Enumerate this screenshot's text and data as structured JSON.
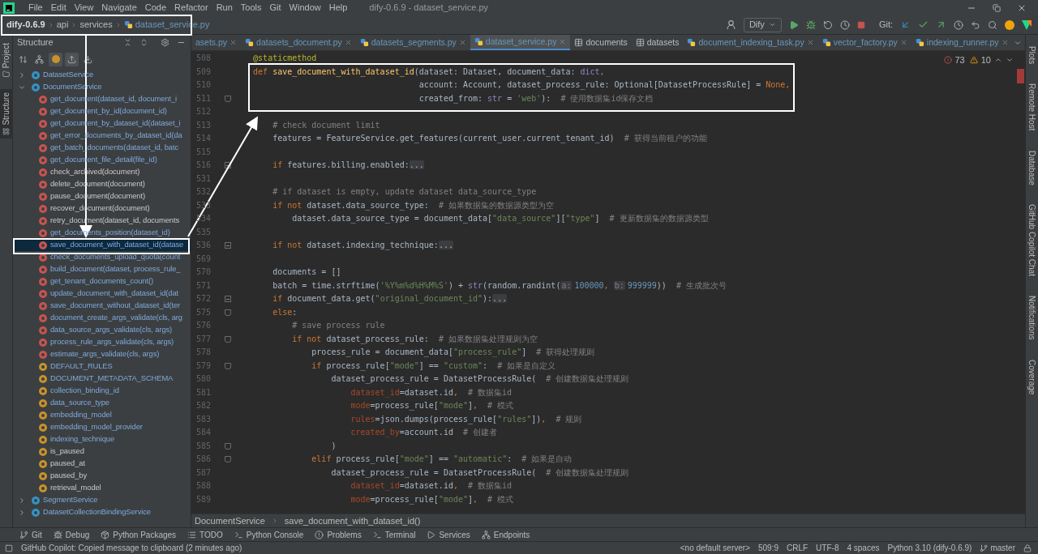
{
  "menu_bar": {
    "items": [
      "File",
      "Edit",
      "View",
      "Navigate",
      "Code",
      "Refactor",
      "Run",
      "Tools",
      "Git",
      "Window",
      "Help"
    ],
    "title": "dify-0.6.9 - dataset_service.py"
  },
  "navigation_bar": {
    "breadcrumbs": [
      "dify-0.6.9",
      "api",
      "services",
      "dataset_service.py"
    ],
    "run_config": "Dify",
    "git_label": "Git:"
  },
  "left_stripe": [
    {
      "label": "Project",
      "selected": false
    },
    {
      "label": "Structure",
      "selected": true
    }
  ],
  "structure_panel": {
    "title": "Structure",
    "toolbar": [
      {
        "kind": "sort",
        "on": false
      },
      {
        "kind": "hierarchy",
        "on": false
      },
      {
        "kind": "fields",
        "on": true
      },
      {
        "kind": "inherited",
        "on": true
      },
      {
        "kind": "anonymous",
        "on": false
      }
    ],
    "tree": [
      {
        "label": "DatasetService",
        "kind": "class",
        "expanded": false,
        "modified": true,
        "selected": false
      },
      {
        "label": "DocumentService",
        "kind": "class",
        "expanded": true,
        "modified": true,
        "selected": false,
        "children": [
          {
            "label": "get_document(dataset_id, document_i",
            "kind": "method",
            "modified": true,
            "selected": false
          },
          {
            "label": "get_document_by_id(document_id)",
            "kind": "method",
            "modified": true,
            "selected": false
          },
          {
            "label": "get_document_by_dataset_id(dataset_i",
            "kind": "method",
            "modified": true,
            "selected": false
          },
          {
            "label": "get_error_documents_by_dataset_id(da",
            "kind": "method",
            "modified": true,
            "selected": false
          },
          {
            "label": "get_batch_documents(dataset_id, batc",
            "kind": "method",
            "modified": true,
            "selected": false
          },
          {
            "label": "get_document_file_detail(file_id)",
            "kind": "method",
            "modified": true,
            "selected": false
          },
          {
            "label": "check_archived(document)",
            "kind": "method",
            "modified": false,
            "selected": false
          },
          {
            "label": "delete_document(document)",
            "kind": "method",
            "modified": false,
            "selected": false
          },
          {
            "label": "pause_document(document)",
            "kind": "method",
            "modified": false,
            "selected": false
          },
          {
            "label": "recover_document(document)",
            "kind": "method",
            "modified": false,
            "selected": false
          },
          {
            "label": "retry_document(dataset_id, documents",
            "kind": "method",
            "modified": false,
            "selected": false
          },
          {
            "label": "get_documents_position(dataset_id)",
            "kind": "method",
            "modified": true,
            "selected": false
          },
          {
            "label": "save_document_with_dataset_id(datase",
            "kind": "method",
            "modified": true,
            "selected": true
          },
          {
            "label": "check_documents_upload_quota(count",
            "kind": "method",
            "modified": true,
            "selected": false
          },
          {
            "label": "build_document(dataset, process_rule_",
            "kind": "method",
            "modified": true,
            "selected": false
          },
          {
            "label": "get_tenant_documents_count()",
            "kind": "method",
            "modified": true,
            "selected": false
          },
          {
            "label": "update_document_with_dataset_id(dat",
            "kind": "method",
            "modified": true,
            "selected": false
          },
          {
            "label": "save_document_without_dataset_id(ter",
            "kind": "method",
            "modified": true,
            "selected": false
          },
          {
            "label": "document_create_args_validate(cls, arg",
            "kind": "method",
            "modified": true,
            "selected": false
          },
          {
            "label": "data_source_args_validate(cls, args)",
            "kind": "method",
            "modified": true,
            "selected": false
          },
          {
            "label": "process_rule_args_validate(cls, args)",
            "kind": "method",
            "modified": true,
            "selected": false
          },
          {
            "label": "estimate_args_validate(cls, args)",
            "kind": "method",
            "modified": true,
            "selected": false
          },
          {
            "label": "DEFAULT_RULES",
            "kind": "field",
            "modified": true,
            "selected": false
          },
          {
            "label": "DOCUMENT_METADATA_SCHEMA",
            "kind": "field",
            "modified": true,
            "selected": false
          },
          {
            "label": "collection_binding_id",
            "kind": "field",
            "modified": true,
            "selected": false
          },
          {
            "label": "data_source_type",
            "kind": "field",
            "modified": true,
            "selected": false
          },
          {
            "label": "embedding_model",
            "kind": "field",
            "modified": true,
            "selected": false
          },
          {
            "label": "embedding_model_provider",
            "kind": "field",
            "modified": true,
            "selected": false
          },
          {
            "label": "indexing_technique",
            "kind": "field",
            "modified": true,
            "selected": false
          },
          {
            "label": "is_paused",
            "kind": "field",
            "modified": false,
            "selected": false
          },
          {
            "label": "paused_at",
            "kind": "field",
            "modified": false,
            "selected": false
          },
          {
            "label": "paused_by",
            "kind": "field",
            "modified": false,
            "selected": false
          },
          {
            "label": "retrieval_model",
            "kind": "field",
            "modified": false,
            "selected": false
          }
        ]
      },
      {
        "label": "SegmentService",
        "kind": "class",
        "expanded": false,
        "modified": true,
        "selected": false
      },
      {
        "label": "DatasetCollectionBindingService",
        "kind": "class",
        "expanded": false,
        "modified": true,
        "selected": false
      }
    ]
  },
  "editor": {
    "tabs": [
      {
        "label": "asets.py",
        "kind": "python",
        "selected": false
      },
      {
        "label": "datasets_document.py",
        "kind": "python",
        "selected": false
      },
      {
        "label": "datasets_segments.py",
        "kind": "python",
        "selected": false
      },
      {
        "label": "dataset_service.py",
        "kind": "python",
        "selected": true
      },
      {
        "label": "documents",
        "kind": "table",
        "selected": false
      },
      {
        "label": "datasets",
        "kind": "table",
        "selected": false
      },
      {
        "label": "document_indexing_task.py",
        "kind": "python",
        "selected": false
      },
      {
        "label": "vector_factory.py",
        "kind": "python",
        "selected": false
      },
      {
        "label": "indexing_runner.py",
        "kind": "python",
        "selected": false
      }
    ],
    "inspections": {
      "errors": "73",
      "warnings": "10"
    },
    "lines": [
      {
        "number": "508",
        "tokens": [
          {
            "kind": "deco",
            "text": "    @staticmethod"
          }
        ]
      },
      {
        "number": "509",
        "tokens": [
          {
            "kind": "kw",
            "text": "    def "
          },
          {
            "kind": "fn",
            "text": "save_document_with_dataset_id"
          },
          {
            "kind": "plain",
            "text": "(dataset: Dataset, document_data: "
          },
          {
            "kind": "builtin",
            "text": "dict"
          },
          {
            "kind": "kw",
            "text": ","
          }
        ]
      },
      {
        "number": "510",
        "tokens": [
          {
            "kind": "plain",
            "text": "                                      account: Account, dataset_process_rule: Optional[DatasetProcessRule] = "
          },
          {
            "kind": "kw",
            "text": "None,"
          }
        ]
      },
      {
        "number": "511",
        "collapsed": false,
        "tokens": [
          {
            "kind": "plain",
            "text": "                                      created_from: "
          },
          {
            "kind": "builtin",
            "text": "str"
          },
          {
            "kind": "plain",
            "text": " = "
          },
          {
            "kind": "str",
            "text": "'web'"
          },
          {
            "kind": "plain",
            "text": "):  "
          },
          {
            "kind": "cmt",
            "text": "# 使用数据集id保存文档"
          }
        ]
      },
      {
        "number": "512"
      },
      {
        "number": "513",
        "tokens": [
          {
            "kind": "cmt",
            "text": "        # check document limit"
          }
        ]
      },
      {
        "number": "514",
        "tokens": [
          {
            "kind": "plain",
            "text": "        features = FeatureService.get_features(current_user.current_tenant_id)  "
          },
          {
            "kind": "cmt",
            "text": "# 获得当前租户的功能"
          }
        ]
      },
      {
        "number": "515"
      },
      {
        "number": "516",
        "collapsed": true,
        "tokens": [
          {
            "kind": "kw",
            "text": "        if "
          },
          {
            "kind": "plain",
            "text": "features.billing.enabled:"
          },
          {
            "kind": "fold",
            "text": "..."
          }
        ]
      },
      {
        "number": "531"
      },
      {
        "number": "532",
        "tokens": [
          {
            "kind": "cmt",
            "text": "        # if dataset is empty, update dataset data_source_type"
          }
        ]
      },
      {
        "number": "533",
        "tokens": [
          {
            "kind": "kw",
            "text": "        if not "
          },
          {
            "kind": "plain",
            "text": "dataset.data_source_type:  "
          },
          {
            "kind": "cmt",
            "text": "# 如果数据集的数据源类型为空"
          }
        ]
      },
      {
        "number": "534",
        "tokens": [
          {
            "kind": "plain",
            "text": "            dataset.data_source_type = document_data["
          },
          {
            "kind": "str",
            "text": "\"data_source\""
          },
          {
            "kind": "plain",
            "text": "]["
          },
          {
            "kind": "str",
            "text": "\"type\""
          },
          {
            "kind": "plain",
            "text": "]  "
          },
          {
            "kind": "cmt",
            "text": "# 更新数据集的数据源类型"
          }
        ]
      },
      {
        "number": "535"
      },
      {
        "number": "536",
        "collapsed": true,
        "tokens": [
          {
            "kind": "kw",
            "text": "        if not "
          },
          {
            "kind": "plain",
            "text": "dataset.indexing_technique:"
          },
          {
            "kind": "fold",
            "text": "..."
          }
        ]
      },
      {
        "number": "569"
      },
      {
        "number": "570",
        "tokens": [
          {
            "kind": "plain",
            "text": "        documents = []"
          }
        ]
      },
      {
        "number": "571",
        "tokens": [
          {
            "kind": "plain",
            "text": "        batch = time.strftime("
          },
          {
            "kind": "str",
            "text": "'%Y%m%d%H%M%S'"
          },
          {
            "kind": "plain",
            "text": ") + "
          },
          {
            "kind": "builtin",
            "text": "str"
          },
          {
            "kind": "plain",
            "text": "(random.randint("
          },
          {
            "kind": "hint",
            "text": "a:"
          },
          {
            "kind": "num",
            "text": "100000"
          },
          {
            "kind": "kw",
            "text": ", "
          },
          {
            "kind": "hint",
            "text": "b:"
          },
          {
            "kind": "num",
            "text": "999999"
          },
          {
            "kind": "plain",
            "text": "))  "
          },
          {
            "kind": "cmt",
            "text": "# 生成批次号"
          }
        ]
      },
      {
        "number": "572",
        "collapsed": true,
        "tokens": [
          {
            "kind": "kw",
            "text": "        if "
          },
          {
            "kind": "plain",
            "text": "document_data.get("
          },
          {
            "kind": "str",
            "text": "\"original_document_id\""
          },
          {
            "kind": "plain",
            "text": "):"
          },
          {
            "kind": "fold",
            "text": "..."
          }
        ]
      },
      {
        "number": "575",
        "collapsed": false,
        "tokens": [
          {
            "kind": "kw",
            "text": "        else"
          },
          {
            "kind": "plain",
            "text": ":"
          }
        ]
      },
      {
        "number": "576",
        "tokens": [
          {
            "kind": "cmt",
            "text": "            # save process rule"
          }
        ]
      },
      {
        "number": "577",
        "collapsed": false,
        "tokens": [
          {
            "kind": "kw",
            "text": "            if not "
          },
          {
            "kind": "plain",
            "text": "dataset_process_rule:  "
          },
          {
            "kind": "cmt",
            "text": "# 如果数据集处理规则为空"
          }
        ]
      },
      {
        "number": "578",
        "tokens": [
          {
            "kind": "plain",
            "text": "                process_rule = document_data["
          },
          {
            "kind": "str",
            "text": "\"process_rule\""
          },
          {
            "kind": "plain",
            "text": "]  "
          },
          {
            "kind": "cmt",
            "text": "# 获得处理规则"
          }
        ]
      },
      {
        "number": "579",
        "collapsed": false,
        "tokens": [
          {
            "kind": "kw",
            "text": "                if "
          },
          {
            "kind": "plain",
            "text": "process_rule["
          },
          {
            "kind": "str",
            "text": "\"mode\""
          },
          {
            "kind": "plain",
            "text": "] == "
          },
          {
            "kind": "str",
            "text": "\"custom\""
          },
          {
            "kind": "plain",
            "text": ":  "
          },
          {
            "kind": "cmt",
            "text": "# 如果是自定义"
          }
        ]
      },
      {
        "number": "580",
        "tokens": [
          {
            "kind": "plain",
            "text": "                    dataset_process_rule = DatasetProcessRule(  "
          },
          {
            "kind": "cmt",
            "text": "# 创建数据集处理规则"
          }
        ]
      },
      {
        "number": "581",
        "tokens": [
          {
            "kind": "param",
            "text": "                        dataset_id"
          },
          {
            "kind": "plain",
            "text": "=dataset.id"
          },
          {
            "kind": "kw",
            "text": ",  "
          },
          {
            "kind": "cmt",
            "text": "# 数据集id"
          }
        ]
      },
      {
        "number": "582",
        "tokens": [
          {
            "kind": "param",
            "text": "                        mode"
          },
          {
            "kind": "plain",
            "text": "=process_rule["
          },
          {
            "kind": "str",
            "text": "\"mode\""
          },
          {
            "kind": "plain",
            "text": "]"
          },
          {
            "kind": "kw",
            "text": ",  "
          },
          {
            "kind": "cmt",
            "text": "# 模式"
          }
        ]
      },
      {
        "number": "583",
        "tokens": [
          {
            "kind": "param",
            "text": "                        rules"
          },
          {
            "kind": "plain",
            "text": "=json.dumps(process_rule["
          },
          {
            "kind": "str",
            "text": "\"rules\""
          },
          {
            "kind": "plain",
            "text": "])"
          },
          {
            "kind": "kw",
            "text": ",  "
          },
          {
            "kind": "cmt",
            "text": "# 规则"
          }
        ]
      },
      {
        "number": "584",
        "tokens": [
          {
            "kind": "param",
            "text": "                        created_by"
          },
          {
            "kind": "plain",
            "text": "=account.id  "
          },
          {
            "kind": "cmt",
            "text": "# 创建者"
          }
        ]
      },
      {
        "number": "585",
        "collapsed": false,
        "tokens": [
          {
            "kind": "plain",
            "text": "                    )"
          }
        ]
      },
      {
        "number": "586",
        "collapsed": false,
        "tokens": [
          {
            "kind": "kw",
            "text": "                elif "
          },
          {
            "kind": "plain",
            "text": "process_rule["
          },
          {
            "kind": "str",
            "text": "\"mode\""
          },
          {
            "kind": "plain",
            "text": "] == "
          },
          {
            "kind": "str",
            "text": "\"automatic\""
          },
          {
            "kind": "plain",
            "text": ":  "
          },
          {
            "kind": "cmt",
            "text": "# 如果是自动"
          }
        ]
      },
      {
        "number": "587",
        "tokens": [
          {
            "kind": "plain",
            "text": "                    dataset_process_rule = DatasetProcessRule(  "
          },
          {
            "kind": "cmt",
            "text": "# 创建数据集处理规则"
          }
        ]
      },
      {
        "number": "588",
        "tokens": [
          {
            "kind": "param",
            "text": "                        dataset_id"
          },
          {
            "kind": "plain",
            "text": "=dataset.id"
          },
          {
            "kind": "kw",
            "text": ",  "
          },
          {
            "kind": "cmt",
            "text": "# 数据集id"
          }
        ]
      },
      {
        "number": "589",
        "tokens": [
          {
            "kind": "param",
            "text": "                        mode"
          },
          {
            "kind": "plain",
            "text": "=process_rule["
          },
          {
            "kind": "str",
            "text": "\"mode\""
          },
          {
            "kind": "plain",
            "text": "]"
          },
          {
            "kind": "kw",
            "text": ",  "
          },
          {
            "kind": "cmt",
            "text": "# 模式"
          }
        ]
      }
    ],
    "breadcrumbs": [
      "DocumentService",
      "save_document_with_dataset_id()"
    ]
  },
  "right_stripe": [
    "Plots",
    "Remote Host",
    "Database",
    "GitHub Copilot Chat",
    "Notifications",
    "Coverage"
  ],
  "tool_windows": [
    {
      "label": "Git",
      "kind": "git"
    },
    {
      "label": "Debug",
      "kind": "debug"
    },
    {
      "label": "Python Packages",
      "kind": "packages"
    },
    {
      "label": "TODO",
      "kind": "todo"
    },
    {
      "label": "Python Console",
      "kind": "console"
    },
    {
      "label": "Problems",
      "kind": "problems"
    },
    {
      "label": "Terminal",
      "kind": "terminal"
    },
    {
      "label": "Services",
      "kind": "services"
    },
    {
      "label": "Endpoints",
      "kind": "endpoints"
    }
  ],
  "status_bar": {
    "message": "GitHub Copilot: Copied message to clipboard (2 minutes ago)",
    "items": [
      "<no default server>",
      "509:9",
      "CRLF",
      "UTF-8",
      "4 spaces",
      "Python 3.10 (dify-0.6.9)"
    ],
    "branch": "master"
  }
}
